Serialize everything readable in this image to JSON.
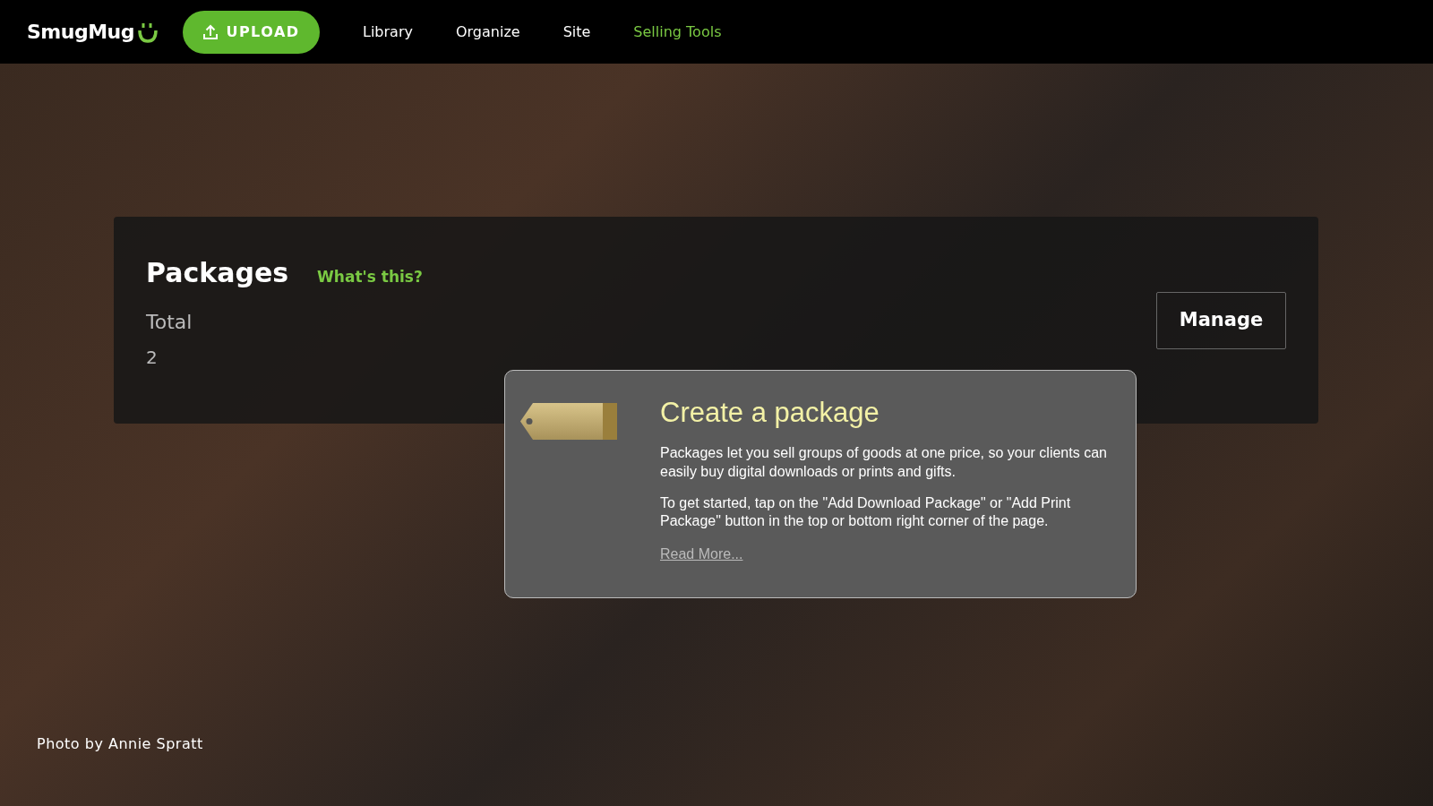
{
  "navbar": {
    "logo": "SmugMug",
    "upload_button": "UPLOAD",
    "items": [
      {
        "label": "Library",
        "selected": false
      },
      {
        "label": "Organize",
        "selected": false
      },
      {
        "label": "Site",
        "selected": false
      },
      {
        "label": "Selling Tools",
        "selected": true
      }
    ]
  },
  "packages_panel": {
    "title": "Packages",
    "help_link": "What's this?",
    "stat_label": "Total",
    "stat_value": "2",
    "manage_button": "Manage"
  },
  "popup": {
    "title": "Create a package",
    "paragraphs": [
      "Packages let you sell groups of goods at one price, so your clients can easily buy digital downloads or prints and gifts.",
      "To get started, tap on the \"Add Download Package\" or \"Add Print Package\" button in the top or bottom right corner of the page."
    ],
    "link": "Read More..."
  },
  "photo_credit": "Photo by Annie Spratt"
}
